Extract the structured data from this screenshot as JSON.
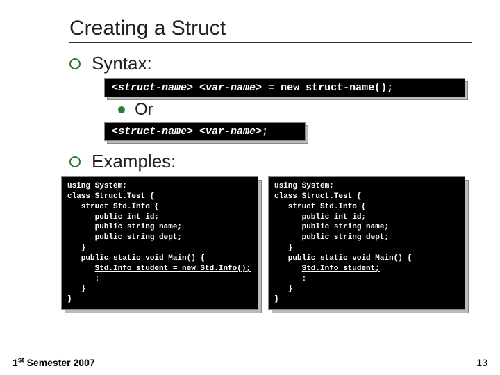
{
  "title": "Creating a Struct",
  "syntax": {
    "heading": "Syntax:",
    "line1_a": "<struct-name>",
    "line1_b": "<var-name>",
    "line1_rest": " = new struct-name();",
    "or_label": "Or",
    "line2_a": "<struct-name>",
    "line2_b": "<var-name>",
    "line2_end": ";"
  },
  "examples": {
    "heading": "Examples:",
    "left": {
      "l0": "using System;",
      "l1": "class Struct.Test {",
      "l2": "   struct Std.Info {",
      "l3": "      public int id;",
      "l4": "      public string name;",
      "l5": "      public string dept;",
      "l6": "   }",
      "l7": "   public static void Main() {",
      "l8a": "      ",
      "l8u": "Std.Info student = new Std.Info();",
      "l9": "      :",
      "l10": "   }",
      "l11": "}"
    },
    "right": {
      "l0": "using System;",
      "l1": "class Struct.Test {",
      "l2": "   struct Std.Info {",
      "l3": "      public int id;",
      "l4": "      public string name;",
      "l5": "      public string dept;",
      "l6": "   }",
      "l7": "   public static void Main() {",
      "l8a": "      ",
      "l8u": "Std.Info student;",
      "l9": "      :",
      "l10": "   }",
      "l11": "}"
    }
  },
  "footer": {
    "semester_pre": "1",
    "semester_sup": "st",
    "semester_post": " Semester 2007",
    "page": "13"
  }
}
